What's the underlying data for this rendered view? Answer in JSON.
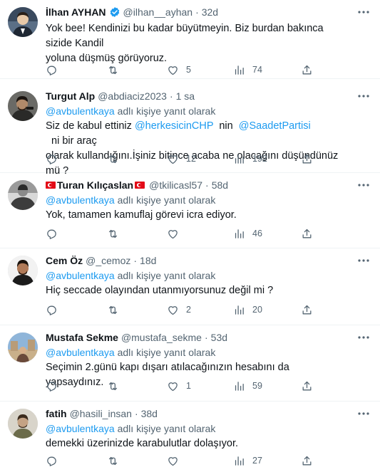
{
  "tweets": [
    {
      "name": "İlhan AYHAN",
      "handle": "@ilhan__ayhan",
      "time": "32d",
      "verified": true,
      "flags": false,
      "replying_prefix": "",
      "replying_mention": "",
      "replying_suffix": "",
      "text_1": "Yok bee! Kendinizi bu kadar büyütmeyin. Biz burdan bakınca sizide Kandil",
      "text_2": "yoluna düşmüş görüyoruz.",
      "reply_count": "",
      "retweet_count": "",
      "like_count": "5",
      "view_count": "74",
      "avatar_colors": [
        "#3a4a5e",
        "#1e2733",
        "#e8c9a8"
      ]
    },
    {
      "name": "Turgut Alp",
      "handle": "@abdiaciz2023",
      "time": "1 sa",
      "verified": false,
      "flags": false,
      "replying_prefix": "",
      "replying_mention": "@avbulentkaya",
      "replying_suffix": " adlı kişiye yanıt olarak",
      "text_a": "Siz de kabul ettiniz ",
      "mention_a": "@herkesicinCHP",
      "text_b": "  nin  ",
      "mention_b": "@SaadetPartisi",
      "text_c": "  ni bir araç",
      "text_2": "olarak kullandığını.İşiniz bitince acaba ne olacağını düşündünüz mü ?",
      "reply_count": "",
      "retweet_count": "",
      "like_count": "12",
      "view_count": "192",
      "avatar_colors": [
        "#4a4a48",
        "#2a2a28",
        "#b08a6a"
      ]
    },
    {
      "name": "Turan Kılıçaslan",
      "handle": "@tkilicasl57",
      "time": "58d",
      "verified": false,
      "flags": true,
      "replying_mention": "@avbulentkaya",
      "replying_suffix": " adlı kişiye yanıt olarak",
      "text_1": "Yok, tamamen kamuflaj görevi icra ediyor.",
      "reply_count": "",
      "retweet_count": "",
      "like_count": "",
      "view_count": "46",
      "avatar_colors": [
        "#9a9a9a",
        "#3c3c3c",
        "#d8d8d8"
      ]
    },
    {
      "name": "Cem Öz",
      "handle": "@_cemoz",
      "time": "18d",
      "verified": false,
      "flags": false,
      "replying_mention": "@avbulentkaya",
      "replying_suffix": " adlı kişiye yanıt olarak",
      "text_1": "Hiç seccade olayından utanmıyorsunuz değil mi ?",
      "reply_count": "",
      "retweet_count": "",
      "like_count": "2",
      "view_count": "20",
      "avatar_colors": [
        "#f2f2f2",
        "#1b1b1b",
        "#b07a58"
      ]
    },
    {
      "name": "Mustafa Sekme",
      "handle": "@mustafa_sekme",
      "time": "53d",
      "verified": false,
      "flags": false,
      "replying_mention": "@avbulentkaya",
      "replying_suffix": " adlı kişiye yanıt olarak",
      "text_1": "Seçimin 2.günü kapı dışarı atılacağınızın hesabını da yapsaydınız.",
      "reply_count": "",
      "retweet_count": "",
      "like_count": "1",
      "view_count": "59",
      "avatar_colors": [
        "#8fb5d9",
        "#6a4a3a",
        "#c9b08a"
      ]
    },
    {
      "name": "fatih",
      "handle": "@hasili_insan",
      "time": "38d",
      "verified": false,
      "flags": false,
      "replying_mention": "@avbulentkaya",
      "replying_suffix": " adlı kişiye yanıt olarak",
      "text_1": "demekki üzerinizde karabulutlar dolaşıyor.",
      "reply_count": "",
      "retweet_count": "",
      "like_count": "",
      "view_count": "27",
      "avatar_colors": [
        "#d8d4ca",
        "#6b6b4a",
        "#c4a284"
      ]
    }
  ],
  "icons": {
    "reply": "reply-icon",
    "retweet": "retweet-icon",
    "like": "heart-icon",
    "views": "views-icon",
    "share": "share-icon",
    "more": "more-icon",
    "verified": "verified-badge-icon"
  },
  "colors": {
    "link": "#1d9bf0",
    "muted": "#536471",
    "text": "#0f1419",
    "divider": "#eff3f4"
  }
}
